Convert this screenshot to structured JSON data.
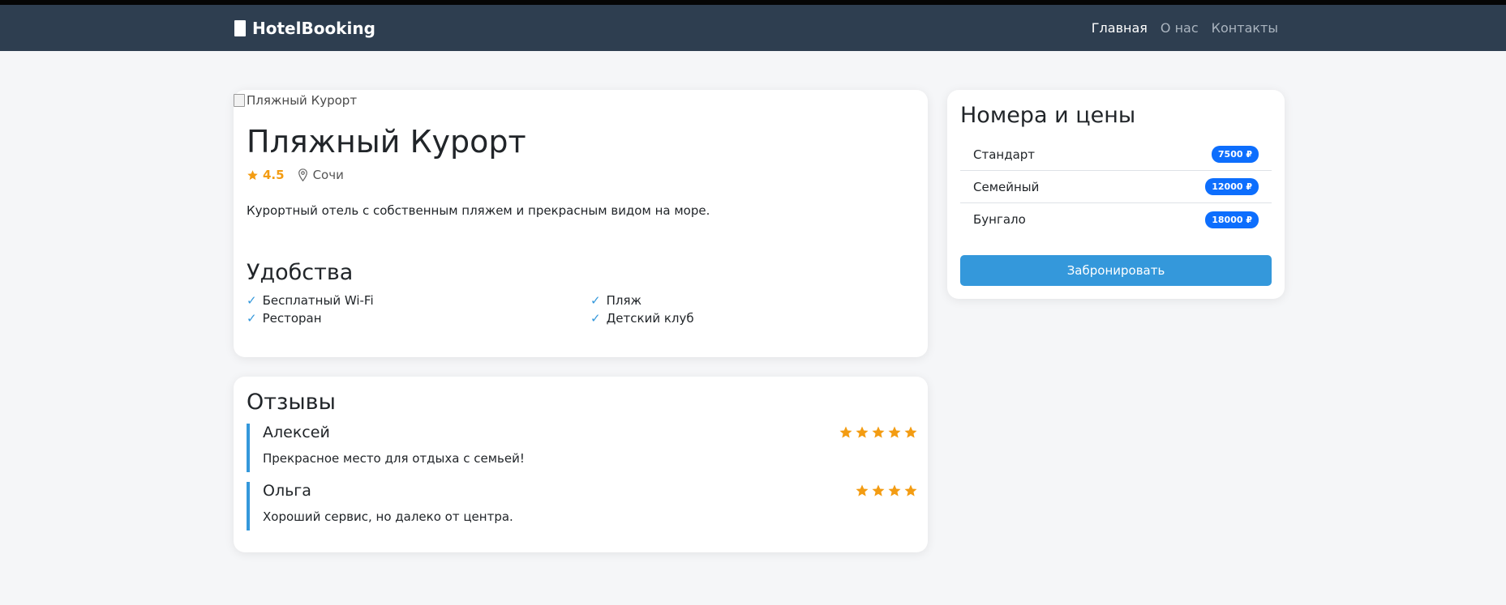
{
  "navbar": {
    "brand": "HotelBooking",
    "links": [
      {
        "label": "Главная",
        "active": true
      },
      {
        "label": "О нас",
        "active": false
      },
      {
        "label": "Контакты",
        "active": false
      }
    ]
  },
  "hotel": {
    "image_alt": "Пляжный Курорт",
    "name": "Пляжный Курорт",
    "rating": "4.5",
    "location": "Сочи",
    "description": "Курортный отель с собственным пляжем и прекрасным видом на море.",
    "amenities_title": "Удобства",
    "amenities": [
      "Бесплатный Wi-Fi",
      "Пляж",
      "Ресторан",
      "Детский клуб"
    ],
    "check_glyph": "✓"
  },
  "reviews": {
    "title": "Отзывы",
    "items": [
      {
        "author": "Алексей",
        "text": "Прекрасное место для отдыха с семьей!",
        "stars": 5
      },
      {
        "author": "Ольга",
        "text": "Хороший сервис, но далеко от центра.",
        "stars": 4
      }
    ]
  },
  "rooms": {
    "title": "Номера и цены",
    "items": [
      {
        "name": "Стандарт",
        "price": "7500 ₽"
      },
      {
        "name": "Семейный",
        "price": "12000 ₽"
      },
      {
        "name": "Бунгало",
        "price": "18000 ₽"
      }
    ],
    "book_label": "Забронировать"
  },
  "colors": {
    "navbar_bg": "#2e3e50",
    "accent": "#3498db",
    "star": "#f39c12",
    "badge": "#0d6efd"
  }
}
